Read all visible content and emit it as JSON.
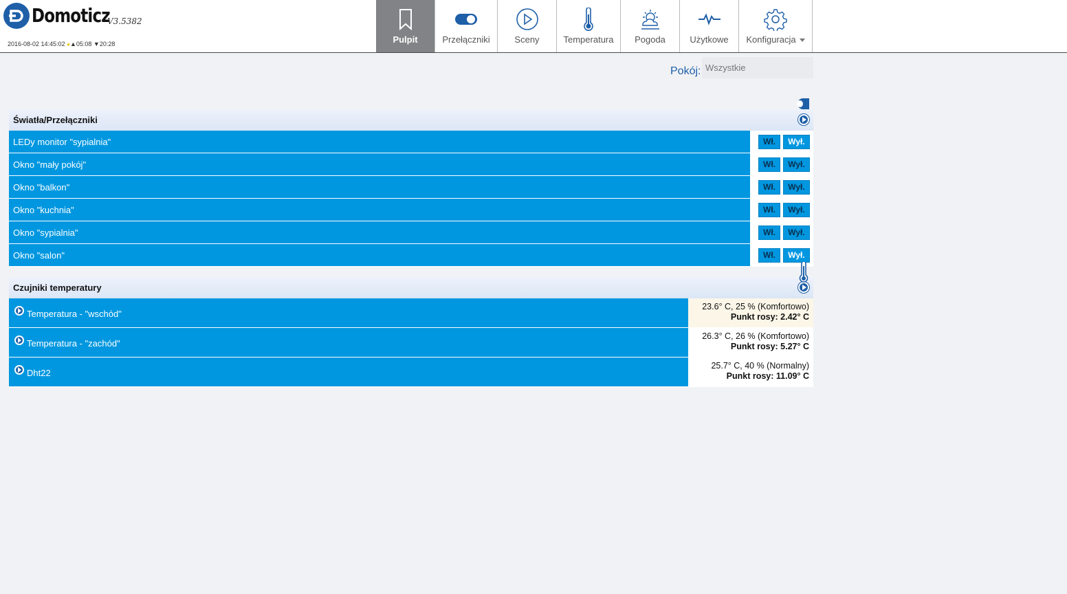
{
  "brand": {
    "name": "Domoticz",
    "version": "V3.5382",
    "datetime": "2016-08-02 14:45:02",
    "sunrise": "05:08",
    "sunset": "20:28"
  },
  "nav": [
    {
      "label": "Pulpit",
      "icon": "bookmark-icon",
      "active": true
    },
    {
      "label": "Przełączniki",
      "icon": "toggle-icon"
    },
    {
      "label": "Sceny",
      "icon": "play-circle-icon"
    },
    {
      "label": "Temperatura",
      "icon": "thermometer-icon"
    },
    {
      "label": "Pogoda",
      "icon": "weather-icon"
    },
    {
      "label": "Użytkowe",
      "icon": "pulse-icon"
    },
    {
      "label": "Konfiguracja",
      "icon": "gear-icon",
      "dropdown": true
    }
  ],
  "room": {
    "label": "Pokój:",
    "value": "Wszystkie"
  },
  "switches": {
    "title": "Światła/Przełączniki",
    "on_label": "Wł.",
    "off_label": "Wył.",
    "items": [
      {
        "name": "LEDy monitor \"sypialnia\"",
        "state": "off"
      },
      {
        "name": "Okno \"mały pokój\"",
        "state": "on"
      },
      {
        "name": "Okno \"balkon\"",
        "state": "on"
      },
      {
        "name": "Okno \"kuchnia\"",
        "state": "on"
      },
      {
        "name": "Okno \"sypialnia\"",
        "state": "on"
      },
      {
        "name": "Okno \"salon\"",
        "state": "off"
      }
    ]
  },
  "temperature": {
    "title": "Czujniki temperatury",
    "items": [
      {
        "name": "Temperatura - \"wschód\"",
        "reading": "23.6° C, 25 % (Komfortowo)",
        "dew_label": "Punkt rosy:",
        "dew": "2.42° C"
      },
      {
        "name": "Temperatura - \"zachód\"",
        "reading": "26.3° C, 26 % (Komfortowo)",
        "dew_label": "Punkt rosy:",
        "dew": "5.27° C"
      },
      {
        "name": "Dht22",
        "reading": "25.7° C, 40 % (Normalny)",
        "dew_label": "Punkt rosy:",
        "dew": "11.09° C"
      }
    ]
  },
  "colors": {
    "accent": "#0097e0",
    "brand": "#1e5fa8",
    "active_nav": "#818386"
  }
}
